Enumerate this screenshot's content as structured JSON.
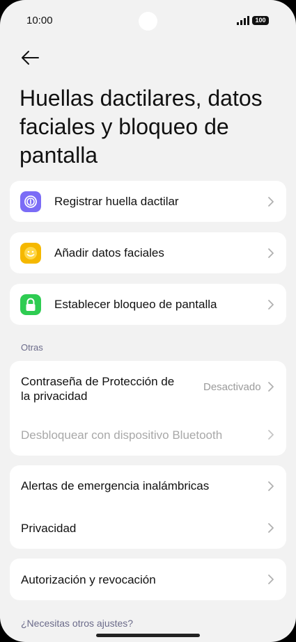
{
  "status_bar": {
    "time": "10:00",
    "battery": "100"
  },
  "page": {
    "title": "Huellas dactilares, datos faciales y bloqueo de pantalla"
  },
  "security_items": [
    {
      "label": "Registrar huella dactilar",
      "icon": "fingerprint-icon",
      "color": "#7b6cf6"
    },
    {
      "label": "Añadir datos faciales",
      "icon": "face-icon",
      "color": "#f5b800"
    },
    {
      "label": "Establecer bloqueo de pantalla",
      "icon": "lock-icon",
      "color": "#2ecc52"
    }
  ],
  "other_section": {
    "header": "Otras",
    "privacy_password": {
      "label_line1": "Contraseña de Protección de",
      "label_line2": "la privacidad",
      "value": "Desactivado"
    },
    "bluetooth_unlock": {
      "label": "Desbloquear con dispositivo Bluetooth",
      "disabled": true
    }
  },
  "alerts_card": {
    "emergency": "Alertas de emergencia inalámbricas",
    "privacy": "Privacidad"
  },
  "authorization": {
    "label": "Autorización y revocación"
  },
  "footer": {
    "link": "¿Necesitas otros ajustes?"
  },
  "colors": {
    "accent_text": "#6b6b8a",
    "disabled_text": "#a8a8a8"
  }
}
